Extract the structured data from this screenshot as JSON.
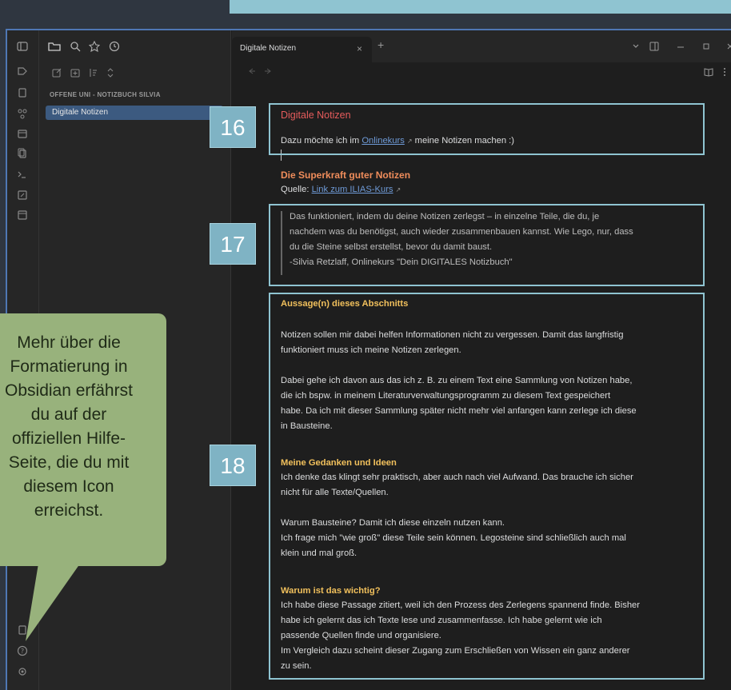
{
  "tab": {
    "title": "Digitale Notizen",
    "close": "×",
    "new": "+"
  },
  "sidebar": {
    "vault_name": "OFFENE UNI - NOTIZBUCH SILVIA",
    "file_item": "Digitale Notizen"
  },
  "note": {
    "title": "Digitale Notizen",
    "intro_before": "Dazu möchte ich im ",
    "intro_link": "Onlinekurs",
    "intro_after": " meine Notizen machen :)",
    "heading1": "Die Superkraft guter Notizen",
    "source_label": "Quelle: ",
    "source_link": "Link zum ILIAS-Kurs",
    "quote": [
      "Das funktioniert, indem du deine Notizen zerlegst – in einzelne Teile, die du, je",
      "nachdem was du benötigst, auch wieder zusammenbauen kannst. Wie Lego, nur, dass",
      "du die Steine selbst erstellst, bevor du damit baust.",
      "-Silvia Retzlaff, Onlinekurs \"Dein DIGITALES Notizbuch\""
    ],
    "section1_heading": "Aussage(n) dieses Abschnitts",
    "section1_p1": [
      "Notizen sollen mir dabei helfen Informationen nicht zu vergessen. Damit das langfristig",
      "funktioniert muss ich meine Notizen zerlegen."
    ],
    "section1_p2": [
      "Dabei gehe ich davon aus das ich z. B. zu einem Text eine Sammlung von Notizen habe,",
      "die ich bspw. in meinem Literaturverwaltungsprogramm zu diesem Text gespeichert",
      "habe. Da ich mit dieser Sammlung später nicht mehr viel anfangen kann zerlege ich diese",
      "in Bausteine."
    ],
    "section2_heading": "Meine Gedanken und Ideen",
    "section2_p1": [
      "Ich denke das klingt sehr praktisch, aber auch nach viel Aufwand. Das brauche ich sicher",
      "nicht für alle Texte/Quellen."
    ],
    "section2_p2": [
      "Warum Bausteine? Damit ich diese einzeln nutzen kann.",
      "Ich frage mich \"wie groß\" diese Teile sein können. Legosteine sind schließlich auch mal",
      "klein und mal groß."
    ],
    "section3_heading": "Warum ist das wichtig?",
    "section3_p1": [
      "Ich habe diese Passage zitiert, weil ich den Prozess des Zerlegens spannend finde. Bisher",
      "habe ich gelernt das ich Texte lese und zusammenfasse. Ich habe gelernt wie ich",
      "passende Quellen finde und organisiere.",
      "Im Vergleich dazu scheint dieser Zugang zum Erschließen von Wissen ein ganz anderer",
      "zu sein."
    ]
  },
  "badges": {
    "b16": "16",
    "b17": "17",
    "b18": "18"
  },
  "callout": {
    "lines": [
      "Mehr über die",
      "Formatierung in",
      "Obsidian erfährst",
      "du auf der",
      "offiziellen Hilfe-",
      "Seite, die du mit",
      "diesem Icon",
      "erreichst."
    ]
  },
  "colors": {
    "accent_box": "#8fc4d1",
    "callout_bg": "#98b27c",
    "title_red": "#e65c5c",
    "heading_orange": "#f08d5b",
    "heading_yellow": "#f1c05c",
    "link_blue": "#6f9bd8"
  },
  "icons": {
    "ribbon": [
      "sidebar-toggle-icon",
      "tag-icon",
      "file-import-icon",
      "graph-icon",
      "calendar-icon",
      "copy-icon",
      "terminal-icon",
      "canvas-icon",
      "template-icon",
      "vault-icon",
      "help-icon",
      "settings-icon"
    ],
    "sidebar_tabs": [
      "folder-icon",
      "search-icon",
      "bookmark-icon",
      "clock-icon"
    ],
    "nav": [
      "new-note-icon",
      "new-folder-icon",
      "sort-icon",
      "collapse-icon"
    ]
  }
}
